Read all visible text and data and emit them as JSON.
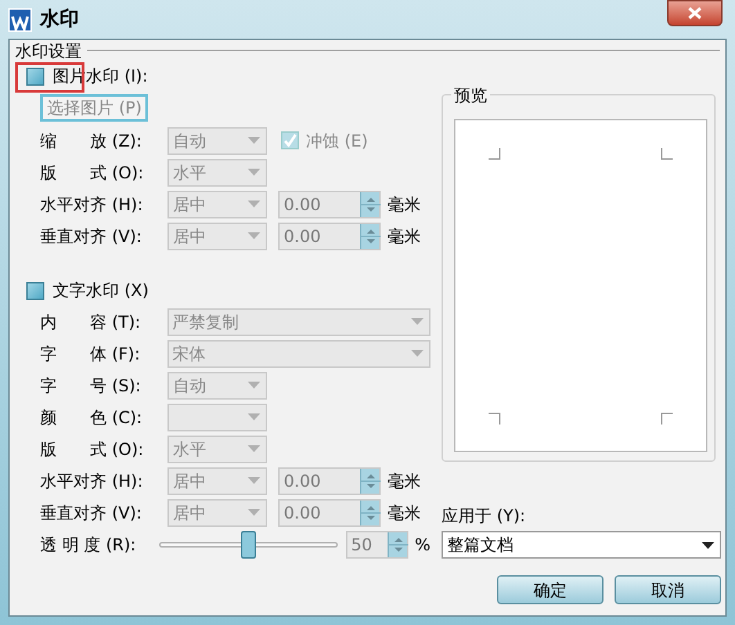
{
  "window": {
    "title": "水印"
  },
  "group": {
    "title": "水印设置"
  },
  "picture_watermark": {
    "label": "图片水印 (I):",
    "checked": false,
    "highlighted": true,
    "select_button": "选择图片 (P)",
    "rows": [
      {
        "label": "缩　　放 (Z):",
        "items": [
          {
            "kind": "combo",
            "value": "自动",
            "disabled": true
          },
          {
            "kind": "checkbox",
            "label": "冲蚀 (E)",
            "checked": true,
            "disabled": true
          }
        ]
      },
      {
        "label": "版　　式 (O):",
        "items": [
          {
            "kind": "combo",
            "value": "水平",
            "disabled": true
          }
        ]
      },
      {
        "label": "水平对齐 (H):",
        "items": [
          {
            "kind": "combo",
            "value": "居中",
            "disabled": true
          },
          {
            "kind": "spin",
            "value": "0.00",
            "disabled": true
          },
          {
            "kind": "unit",
            "text": "毫米"
          }
        ]
      },
      {
        "label": "垂直对齐 (V):",
        "items": [
          {
            "kind": "combo",
            "value": "居中",
            "disabled": true
          },
          {
            "kind": "spin",
            "value": "0.00",
            "disabled": true
          },
          {
            "kind": "unit",
            "text": "毫米"
          }
        ]
      }
    ]
  },
  "text_watermark": {
    "label": "文字水印 (X)",
    "checked": false,
    "rows": [
      {
        "label": "内　　容 (T):",
        "items": [
          {
            "kind": "wide_combo",
            "value": "严禁复制",
            "disabled": true
          }
        ]
      },
      {
        "label": "字　　体 (F):",
        "items": [
          {
            "kind": "wide_combo",
            "value": "宋体",
            "disabled": true
          }
        ]
      },
      {
        "label": "字　　号 (S):",
        "items": [
          {
            "kind": "combo",
            "value": "自动",
            "disabled": true
          }
        ]
      },
      {
        "label": "颜　　色 (C):",
        "items": [
          {
            "kind": "combo",
            "disabled": true
          }
        ]
      },
      {
        "label": "版　　式 (O):",
        "items": [
          {
            "kind": "combo",
            "value": "水平",
            "disabled": true
          }
        ]
      },
      {
        "label": "水平对齐 (H):",
        "items": [
          {
            "kind": "combo",
            "value": "居中",
            "disabled": true
          },
          {
            "kind": "spin",
            "value": "0.00",
            "disabled": true
          },
          {
            "kind": "unit",
            "text": "毫米"
          }
        ]
      },
      {
        "label": "垂直对齐 (V):",
        "items": [
          {
            "kind": "combo",
            "value": "居中",
            "disabled": true
          },
          {
            "kind": "spin",
            "value": "0.00",
            "disabled": true
          },
          {
            "kind": "unit",
            "text": "毫米"
          }
        ]
      },
      {
        "label": "透 明 度 (R):",
        "items": [
          {
            "kind": "slider",
            "level": 0.5
          },
          {
            "kind": "spin",
            "value": "50",
            "disabled": true
          },
          {
            "kind": "unit",
            "text": "%"
          }
        ]
      }
    ]
  },
  "preview": {
    "title": "预览"
  },
  "apply_to": {
    "label": "应用于 (Y):",
    "value": "整篇文档"
  },
  "buttons": [
    "确定",
    "取消"
  ]
}
